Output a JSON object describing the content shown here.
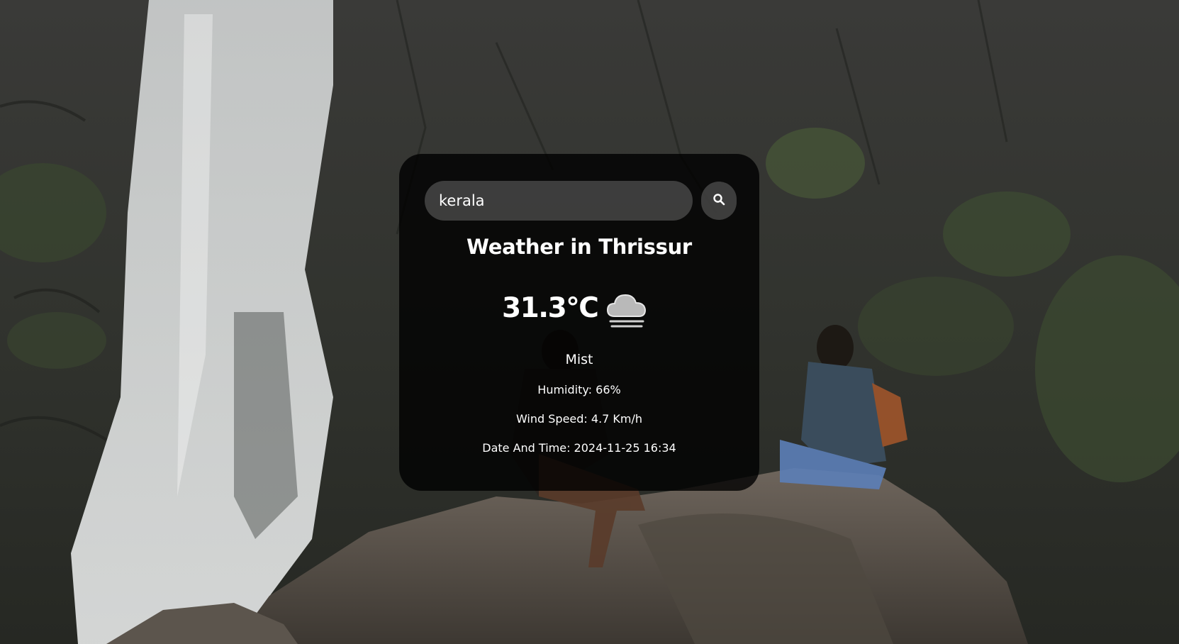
{
  "search": {
    "value": "kerala",
    "icon": "search-icon"
  },
  "weather": {
    "title": "Weather in Thrissur",
    "temperature": "31.3°C",
    "icon": "cloud-icon",
    "description": "Mist",
    "humidity": "Humidity: 66%",
    "wind": "Wind Speed: 4.7 Km/h",
    "datetime": "Date And Time: 2024-11-25 16:34"
  },
  "colors": {
    "card_bg": "#000000",
    "text": "#ffffff",
    "input_bg": "#7c7c7c"
  }
}
